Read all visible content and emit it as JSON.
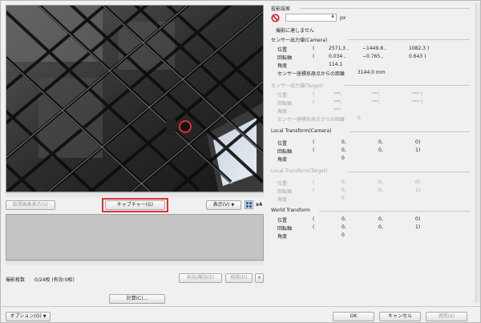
{
  "buttons": {
    "show_captured": "取得画像表示(V)",
    "capture": "キャプチャー(G)",
    "display": "表示(V)",
    "valid_invalid": "有効/無効(E)",
    "delete": "削除(D)",
    "calculate": "計算(C)...",
    "options": "オプション(O)",
    "ok": "OK",
    "cancel": "キャンセル",
    "apply": "適用(A)"
  },
  "zoom_label": "x4",
  "capture_count_label": "撮影枚数",
  "capture_count_value": "0/24枚 (有効:0枚)",
  "right_panel": {
    "projection_error": {
      "title": "投影誤差",
      "unit": "px",
      "status": "撮影に達しません"
    },
    "sensor_camera": {
      "title": "センサー出力値(Camera)",
      "position_label": "位置",
      "position": [
        "(",
        "2571.3 ,",
        "−1449.8 ,",
        "1082.3 )"
      ],
      "rotation_label": "回転軸",
      "rotation": [
        "(",
        "0.034 ,",
        "−0.765 ,",
        "0.643 )"
      ],
      "angle_label": "角度",
      "angle": "114.1",
      "distance_label": "センサー座標系原点からの距離",
      "distance": "3144.0 mm"
    },
    "sensor_target": {
      "title": "センサー出力値(Target)",
      "position_label": "位置",
      "position": [
        "(",
        "***,",
        "***,",
        "*** )"
      ],
      "rotation_label": "回転軸",
      "rotation": [
        "(",
        "***,",
        "***,",
        "*** )"
      ],
      "angle_label": "角度",
      "angle": "***",
      "distance_label": "センサー座標系原点からの距離",
      "distance": "0"
    },
    "local_camera": {
      "title": "Local Transform(Camera)",
      "position_label": "位置",
      "position": [
        "(",
        "0,",
        "0,",
        "0)"
      ],
      "rotation_label": "回転軸",
      "rotation": [
        "(",
        "0,",
        "0,",
        "1)"
      ],
      "angle_label": "角度",
      "angle": "0"
    },
    "local_target": {
      "title": "Local Transform(Target)",
      "position_label": "位置",
      "position": [
        "(",
        "0,",
        "0,",
        "0)"
      ],
      "rotation_label": "回転軸",
      "rotation": [
        "(",
        "0,",
        "0,",
        "1)"
      ],
      "angle_label": "角度",
      "angle": "0"
    },
    "world": {
      "title": "World Transform",
      "position_label": "位置",
      "position": [
        "(",
        "0,",
        "0,",
        "0)"
      ],
      "rotation_label": "回転軸",
      "rotation": [
        "(",
        "0,",
        "0,",
        "1)"
      ],
      "angle_label": "角度",
      "angle": "0"
    }
  },
  "colors": {
    "highlight": "#e03030",
    "no_symbol": "#d82020",
    "preview_bg": "#1c1c1c",
    "list_bg": "#c4c4c4"
  }
}
